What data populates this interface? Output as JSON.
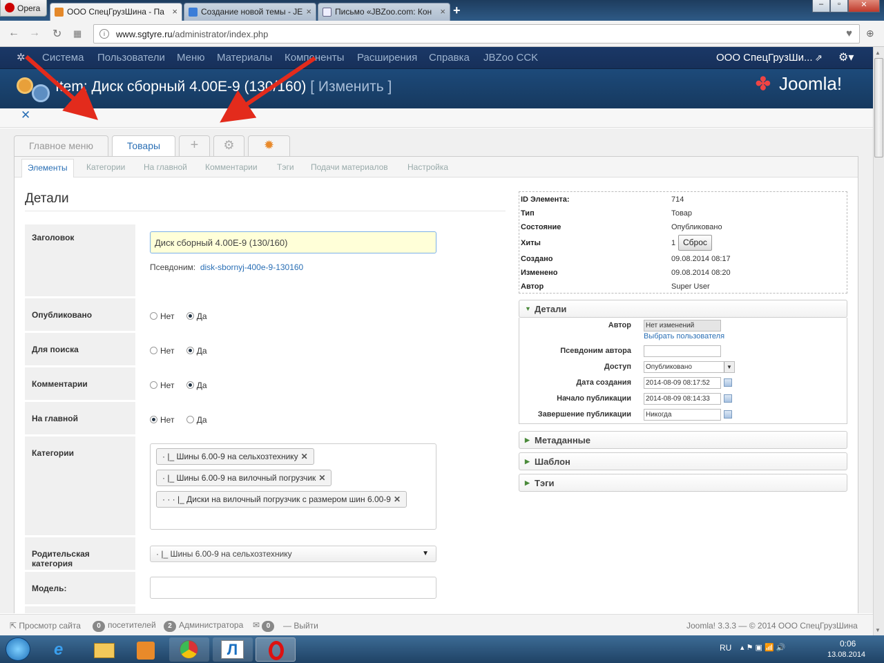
{
  "browser": {
    "menu_label": "Opera",
    "tabs": [
      {
        "title": "ООО СпецГрузШина - Па"
      },
      {
        "title": "Создание новой темы - JE"
      },
      {
        "title": "Письмо «JBZoo.com: Кон"
      }
    ],
    "url_domain": "www.sgtyre.ru",
    "url_path": "/administrator/index.php"
  },
  "joomla_nav": {
    "items": [
      "Система",
      "Пользователи",
      "Меню",
      "Материалы",
      "Компоненты",
      "Расширения",
      "Справка",
      "JBZoo CCK"
    ],
    "site_name": "ООО СпецГрузШи...",
    "title_prefix": "Item: Диск сборный 4.00E-9 (130/160)",
    "title_action": "[ Изменить ]",
    "brand": "Joomla!"
  },
  "top_tabs": {
    "main_menu": "Главное меню",
    "goods": "Товары"
  },
  "sub_tabs": [
    "Элементы",
    "Категории",
    "На главной",
    "Комментарии",
    "Тэги",
    "Подачи материалов",
    "Настройка"
  ],
  "form": {
    "heading": "Детали",
    "title_label": "Заголовок",
    "title_value": "Диск сборный 4.00E-9 (130/160)",
    "alias_label": "Псевдоним:",
    "alias_value": "disk-sbornyj-400e-9-130160",
    "published_label": "Опубликовано",
    "searchable_label": "Для поиска",
    "comments_label": "Комментарии",
    "frontpage_label": "На главной",
    "no": "Нет",
    "yes": "Да",
    "categories_label": "Категории",
    "categories": [
      "·  |_ Шины 6.00-9 на сельхозтехнику",
      "·  |_ Шины 6.00-9 на вилочный погрузчик",
      "·  ·  ·  |_ Диски на вилочный погрузчик с размером шин 6.00-9"
    ],
    "parent_label": "Родительская категория",
    "parent_value": "·  |_ Шины 6.00-9 на сельхозтехнику",
    "model_label": "Модель:"
  },
  "info": [
    {
      "k": "ID Элемента:",
      "v": "714"
    },
    {
      "k": "Тип",
      "v": "Товар"
    },
    {
      "k": "Состояние",
      "v": "Опубликовано"
    },
    {
      "k": "Хиты",
      "v": "1"
    },
    {
      "k": "Создано",
      "v": "09.08.2014 08:17"
    },
    {
      "k": "Изменено",
      "v": "09.08.2014 08:20"
    },
    {
      "k": "Автор",
      "v": "Super User"
    }
  ],
  "reset_button": "Сброс",
  "details_panel": {
    "title": "Детали",
    "author_label": "Автор",
    "author_value": "Нет изменений",
    "choose_user": "Выбрать пользователя",
    "author_alias_label": "Псевдоним автора",
    "access_label": "Доступ",
    "access_value": "Опубликовано",
    "created_label": "Дата создания",
    "created_value": "2014-08-09 08:17:52",
    "publish_up_label": "Начало публикации",
    "publish_up_value": "2014-08-09 08:14:33",
    "publish_down_label": "Завершение публикации",
    "publish_down_value": "Никогда"
  },
  "accordions": [
    "Метаданные",
    "Шаблон",
    "Тэги"
  ],
  "status_bar": {
    "view_site": "Просмотр сайта",
    "visitors_count": "0",
    "visitors_label": "посетителей",
    "admins_count": "2",
    "admins_label": "Администратора",
    "messages_count": "0",
    "logout": "Выйти",
    "version": "Joomla! 3.3.3",
    "copyright": "— © 2014 ООО СпецГрузШина"
  },
  "taskbar": {
    "lang": "RU",
    "time": "0:06",
    "date": "13.08.2014"
  },
  "colors": {
    "joomla_nav": "#17305a",
    "title_bar": "#1d4a7a",
    "link": "#2a6fb5",
    "arrow": "#e32b1c"
  }
}
